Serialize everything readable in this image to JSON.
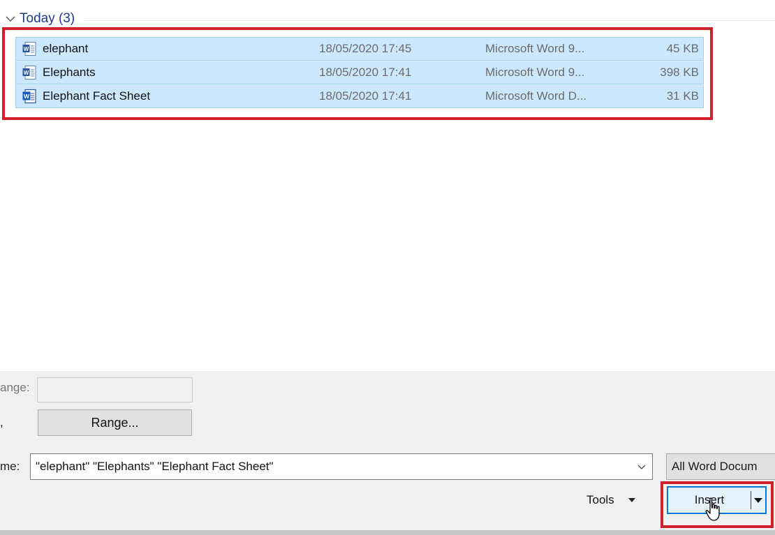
{
  "group": {
    "title": "Today (3)",
    "icon": "chevron-down-icon"
  },
  "files": [
    {
      "name": "elephant",
      "date": "18/05/2020 17:45",
      "type": "Microsoft Word 9...",
      "size": "45 KB",
      "icon": "word-doc-icon"
    },
    {
      "name": "Elephants",
      "date": "18/05/2020 17:41",
      "type": "Microsoft Word 9...",
      "size": "398 KB",
      "icon": "word-doc-icon"
    },
    {
      "name": "Elephant Fact Sheet",
      "date": "18/05/2020 17:41",
      "type": "Microsoft Word D...",
      "size": "31 KB",
      "icon": "word-docx-icon"
    }
  ],
  "options": {
    "range_label": "ange:",
    "range_button": "Range...",
    "row_label": ",",
    "filename_label": "me:",
    "filename_value": "\"elephant\" \"Elephants\" \"Elephant Fact Sheet\"",
    "filter_value": "All Word Docum"
  },
  "actions": {
    "tools_label": "Tools",
    "insert_label": "Insert"
  },
  "colors": {
    "selection": "#cce8ff",
    "selection_border": "#99d1ff",
    "highlight": "#d0202a",
    "accent": "#0078d7"
  }
}
